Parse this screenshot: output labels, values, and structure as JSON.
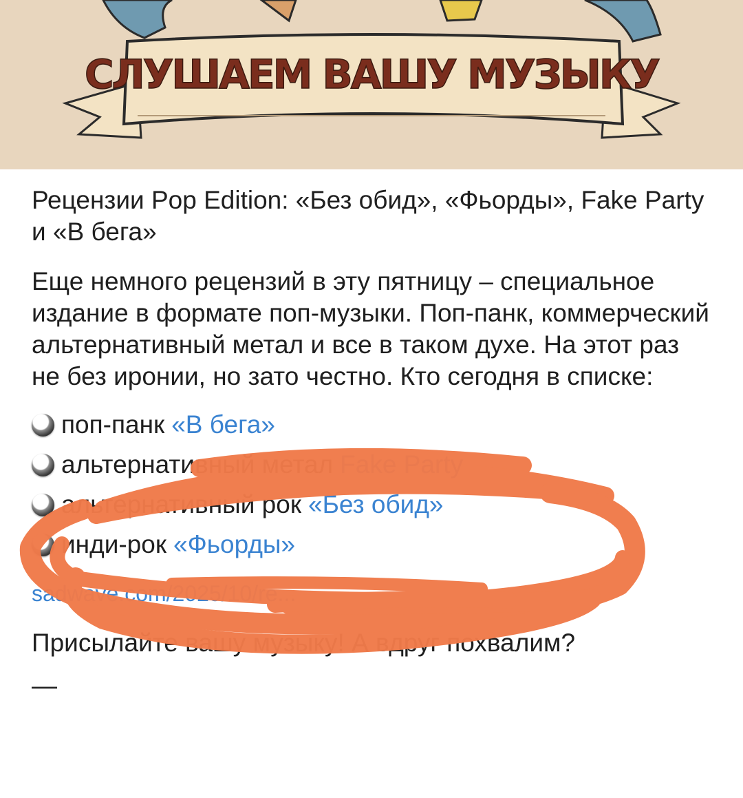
{
  "banner": {
    "title": "СЛУШАЕМ ВАШУ МУЗЫКУ",
    "background": "#e8d6be",
    "ribbon_color": "#f3e3c4",
    "title_color": "#7a2d1d"
  },
  "post": {
    "title": "Рецензии Pop Edition: «Без обид», «Фьорды», Fake Party и «В бега»",
    "body": "Еще немного рецензий в эту пятницу – специальное издание в формате поп-музыки. Поп-панк, коммерческий альтернативный метал и все в таком духе. На этот раз не без иронии, но зато честно. Кто сегодня в списке:",
    "items": [
      {
        "icon": "radio-button-icon",
        "genre": "поп-панк",
        "link": "«В бега»"
      },
      {
        "icon": "radio-button-icon",
        "genre": "альтернативный метал",
        "link": "Fake Party"
      },
      {
        "icon": "radio-button-icon",
        "genre": "альтернативный рок",
        "link": "«Без обид»"
      },
      {
        "icon": "radio-button-icon",
        "genre": "инди-рок",
        "link": "«Фьорды»"
      }
    ],
    "url": "sadwave.com/2025/10/re...",
    "footer": "Присылайте вашу музыку! А вдруг похвалим?",
    "dash": "—"
  },
  "colors": {
    "link": "#3a83d1",
    "text": "#1f1f1f",
    "scribble": "#f07a4a"
  }
}
